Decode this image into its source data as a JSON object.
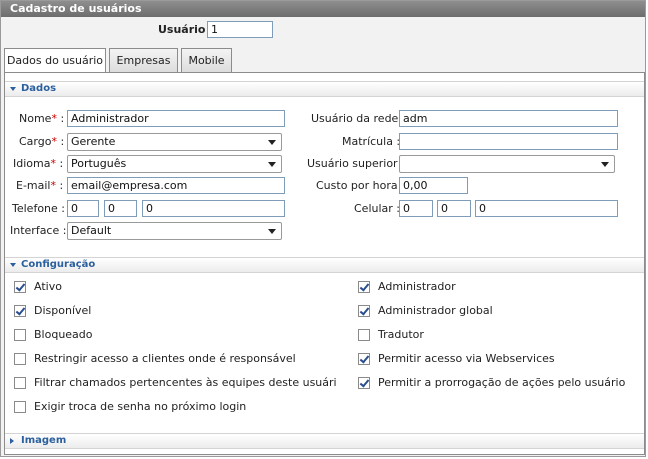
{
  "window": {
    "title": "Cadastro de usuários"
  },
  "header": {
    "usuario_label": "Usuário :",
    "usuario_value": "1"
  },
  "tabs": [
    {
      "label": "Dados do usuário",
      "active": true
    },
    {
      "label": "Empresas",
      "active": false
    },
    {
      "label": "Mobile",
      "active": false
    }
  ],
  "dados": {
    "section_title": "Dados",
    "nome": {
      "label": "Nome",
      "value": "Administrador"
    },
    "cargo": {
      "label": "Cargo",
      "value": "Gerente"
    },
    "idioma": {
      "label": "Idioma",
      "value": "Português"
    },
    "email": {
      "label": "E-mail",
      "value": "email@empresa.com"
    },
    "telefone": {
      "label": "Telefone :",
      "part1": "0",
      "part2": "0",
      "part3": "0"
    },
    "interface": {
      "label": "Interface :",
      "value": "Default"
    },
    "usuario_rede": {
      "label": "Usuário da rede :",
      "value": "adm"
    },
    "matricula": {
      "label": "Matrícula :",
      "value": ""
    },
    "usuario_superior": {
      "label": "Usuário superior :",
      "value": ""
    },
    "custo_hora": {
      "label": "Custo por hora :",
      "value": "0,00"
    },
    "celular": {
      "label": "Celular :",
      "part1": "0",
      "part2": "0",
      "part3": "0"
    },
    "required_mark": "*",
    "colon": " :"
  },
  "configuracao": {
    "section_title": "Configuração",
    "left": [
      {
        "label": "Ativo",
        "checked": true
      },
      {
        "label": "Disponível",
        "checked": true
      },
      {
        "label": "Bloqueado",
        "checked": false
      },
      {
        "label": "Restringir acesso a clientes onde é responsável",
        "checked": false
      },
      {
        "label": "Filtrar chamados pertencentes às equipes deste usuári",
        "checked": false
      },
      {
        "label": "Exigir troca de senha no próximo login",
        "checked": false
      }
    ],
    "right": [
      {
        "label": "Administrador",
        "checked": true
      },
      {
        "label": "Administrador global",
        "checked": true
      },
      {
        "label": "Tradutor",
        "checked": false
      },
      {
        "label": "Permitir acesso via Webservices",
        "checked": true
      },
      {
        "label": "Permitir a prorrogação de ações pelo usuário",
        "checked": true
      }
    ]
  },
  "imagem": {
    "section_title": "Imagem"
  }
}
